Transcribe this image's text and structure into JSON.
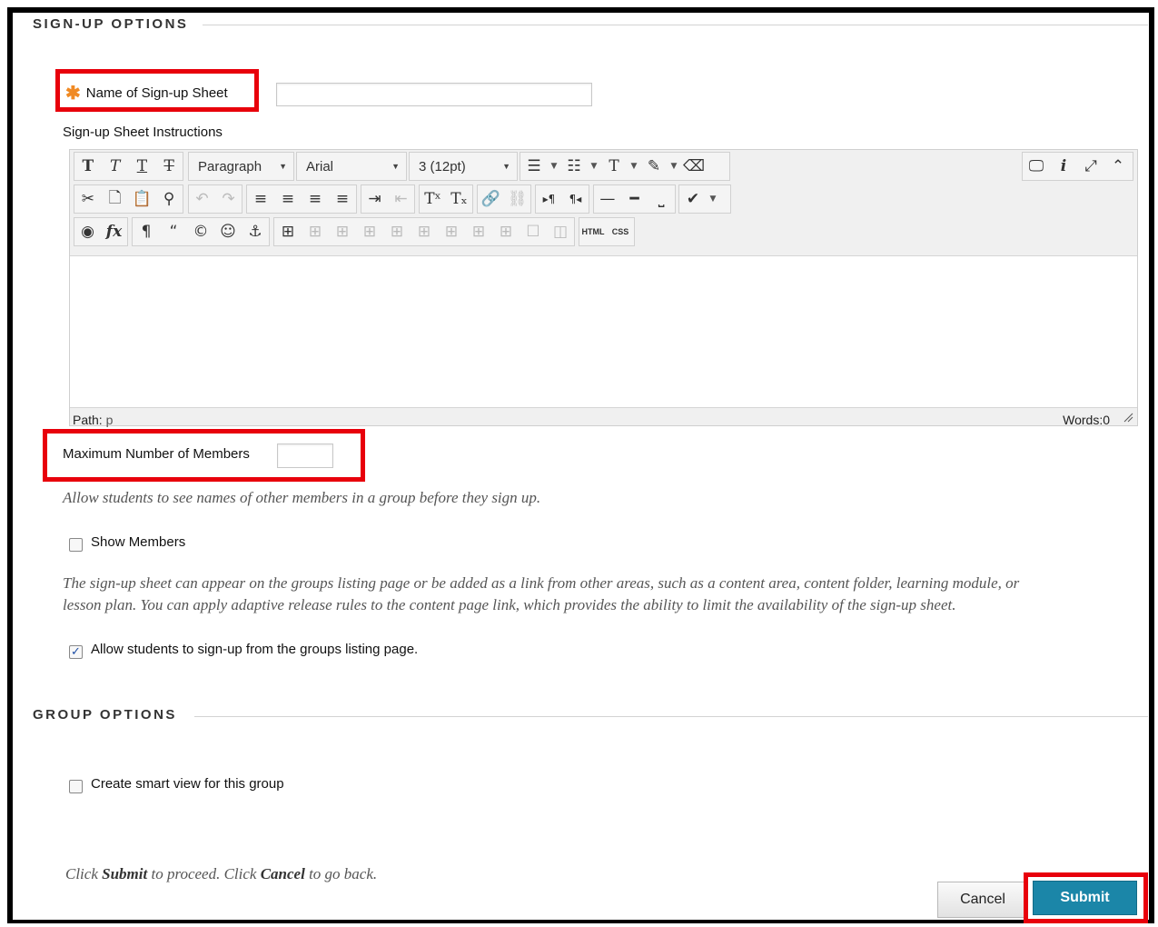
{
  "signup_section": {
    "title": "SIGN-UP OPTIONS"
  },
  "name_field": {
    "label": "Name of Sign-up Sheet",
    "value": "",
    "required_icon": "asterisk-icon"
  },
  "instructions": {
    "label": "Sign-up Sheet Instructions",
    "format_select": "Paragraph",
    "font_select": "Arial",
    "size_select": "3 (12pt)",
    "html_button": "HTML",
    "css_button": "CSS",
    "path_label": "Path:",
    "path_value": "p",
    "words_label": "Words:0"
  },
  "max_members": {
    "label": "Maximum Number of Members",
    "value": ""
  },
  "show_members": {
    "help": "Allow students to see names of other members in a group before they sign up.",
    "label": "Show Members",
    "checked": false
  },
  "listing_help": {
    "line1": "The sign-up sheet can appear on the groups listing page or be added as a link from other areas, such as a content area, content folder, learning module, or",
    "line2": "lesson plan. You can apply adaptive release rules to the content page link, which provides the ability to limit the availability of the sign-up sheet."
  },
  "allow_signup": {
    "label": "Allow students to sign-up from the groups listing page.",
    "checked": true
  },
  "group_section": {
    "title": "GROUP OPTIONS"
  },
  "smart_view": {
    "label": "Create smart view for this group",
    "checked": false
  },
  "footer": {
    "hint_click": "Click",
    "hint_submit": "Submit",
    "hint_mid": "to proceed. Click",
    "hint_cancel": "Cancel",
    "hint_end": "to go back.",
    "cancel_label": "Cancel",
    "submit_label": "Submit"
  },
  "colors": {
    "highlight": "#e8000b",
    "submit": "#1b86a8",
    "required": "#f08a24"
  }
}
